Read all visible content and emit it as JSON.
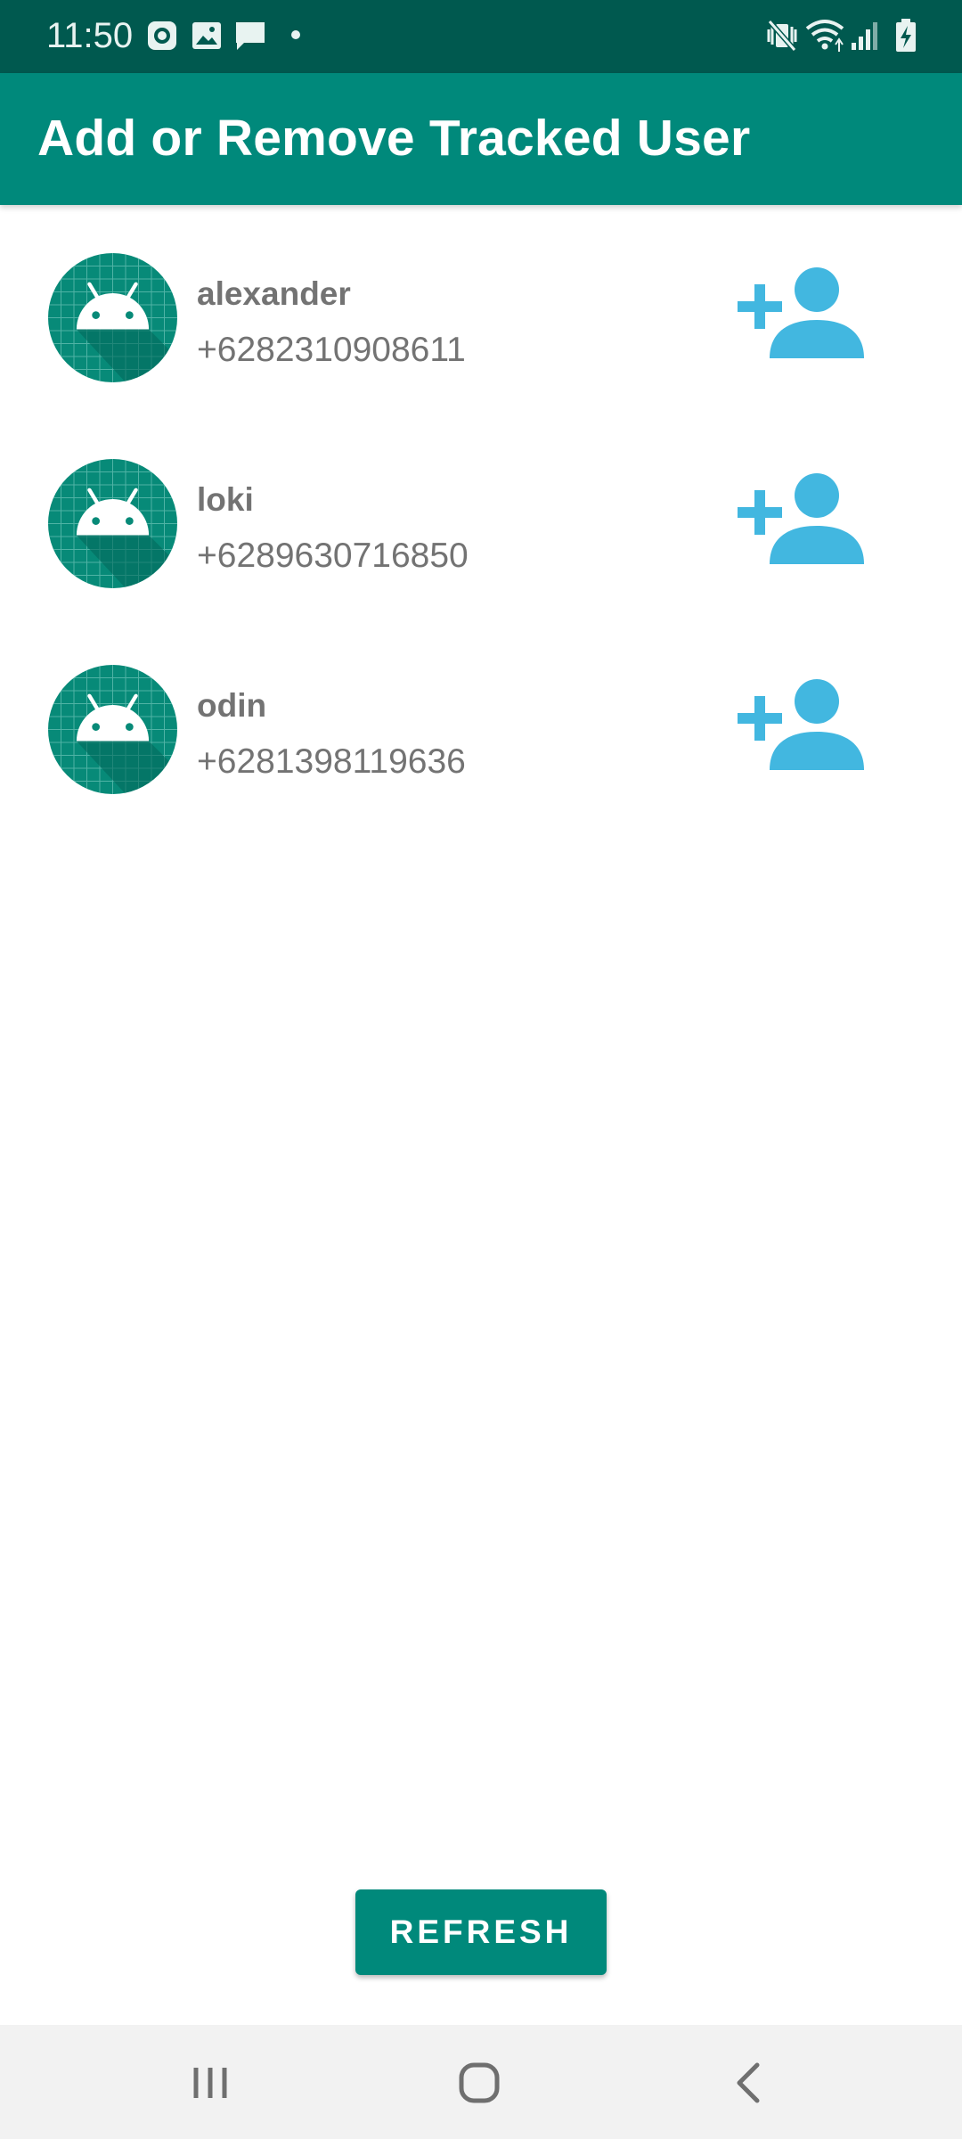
{
  "status_bar": {
    "time": "11:50",
    "left_icons": [
      "screen-record-icon",
      "image-icon",
      "message-icon",
      "dot-icon"
    ],
    "right_icons": [
      "mute-vibrate-icon",
      "wifi-icon",
      "signal-icon",
      "battery-charging-icon"
    ]
  },
  "app_bar": {
    "title": "Add or Remove Tracked User",
    "color": "#00897b"
  },
  "users": [
    {
      "name": "alexander",
      "phone": "+6282310908611"
    },
    {
      "name": "loki",
      "phone": "+6289630716850"
    },
    {
      "name": "odin",
      "phone": "+6281398119636"
    }
  ],
  "row_action_icon": "add-user-icon",
  "accent_color": "#42b7e0",
  "refresh_button": {
    "label": "REFRESH"
  },
  "nav_bar": {
    "icons": [
      "recent-apps-icon",
      "home-icon",
      "back-icon"
    ]
  }
}
